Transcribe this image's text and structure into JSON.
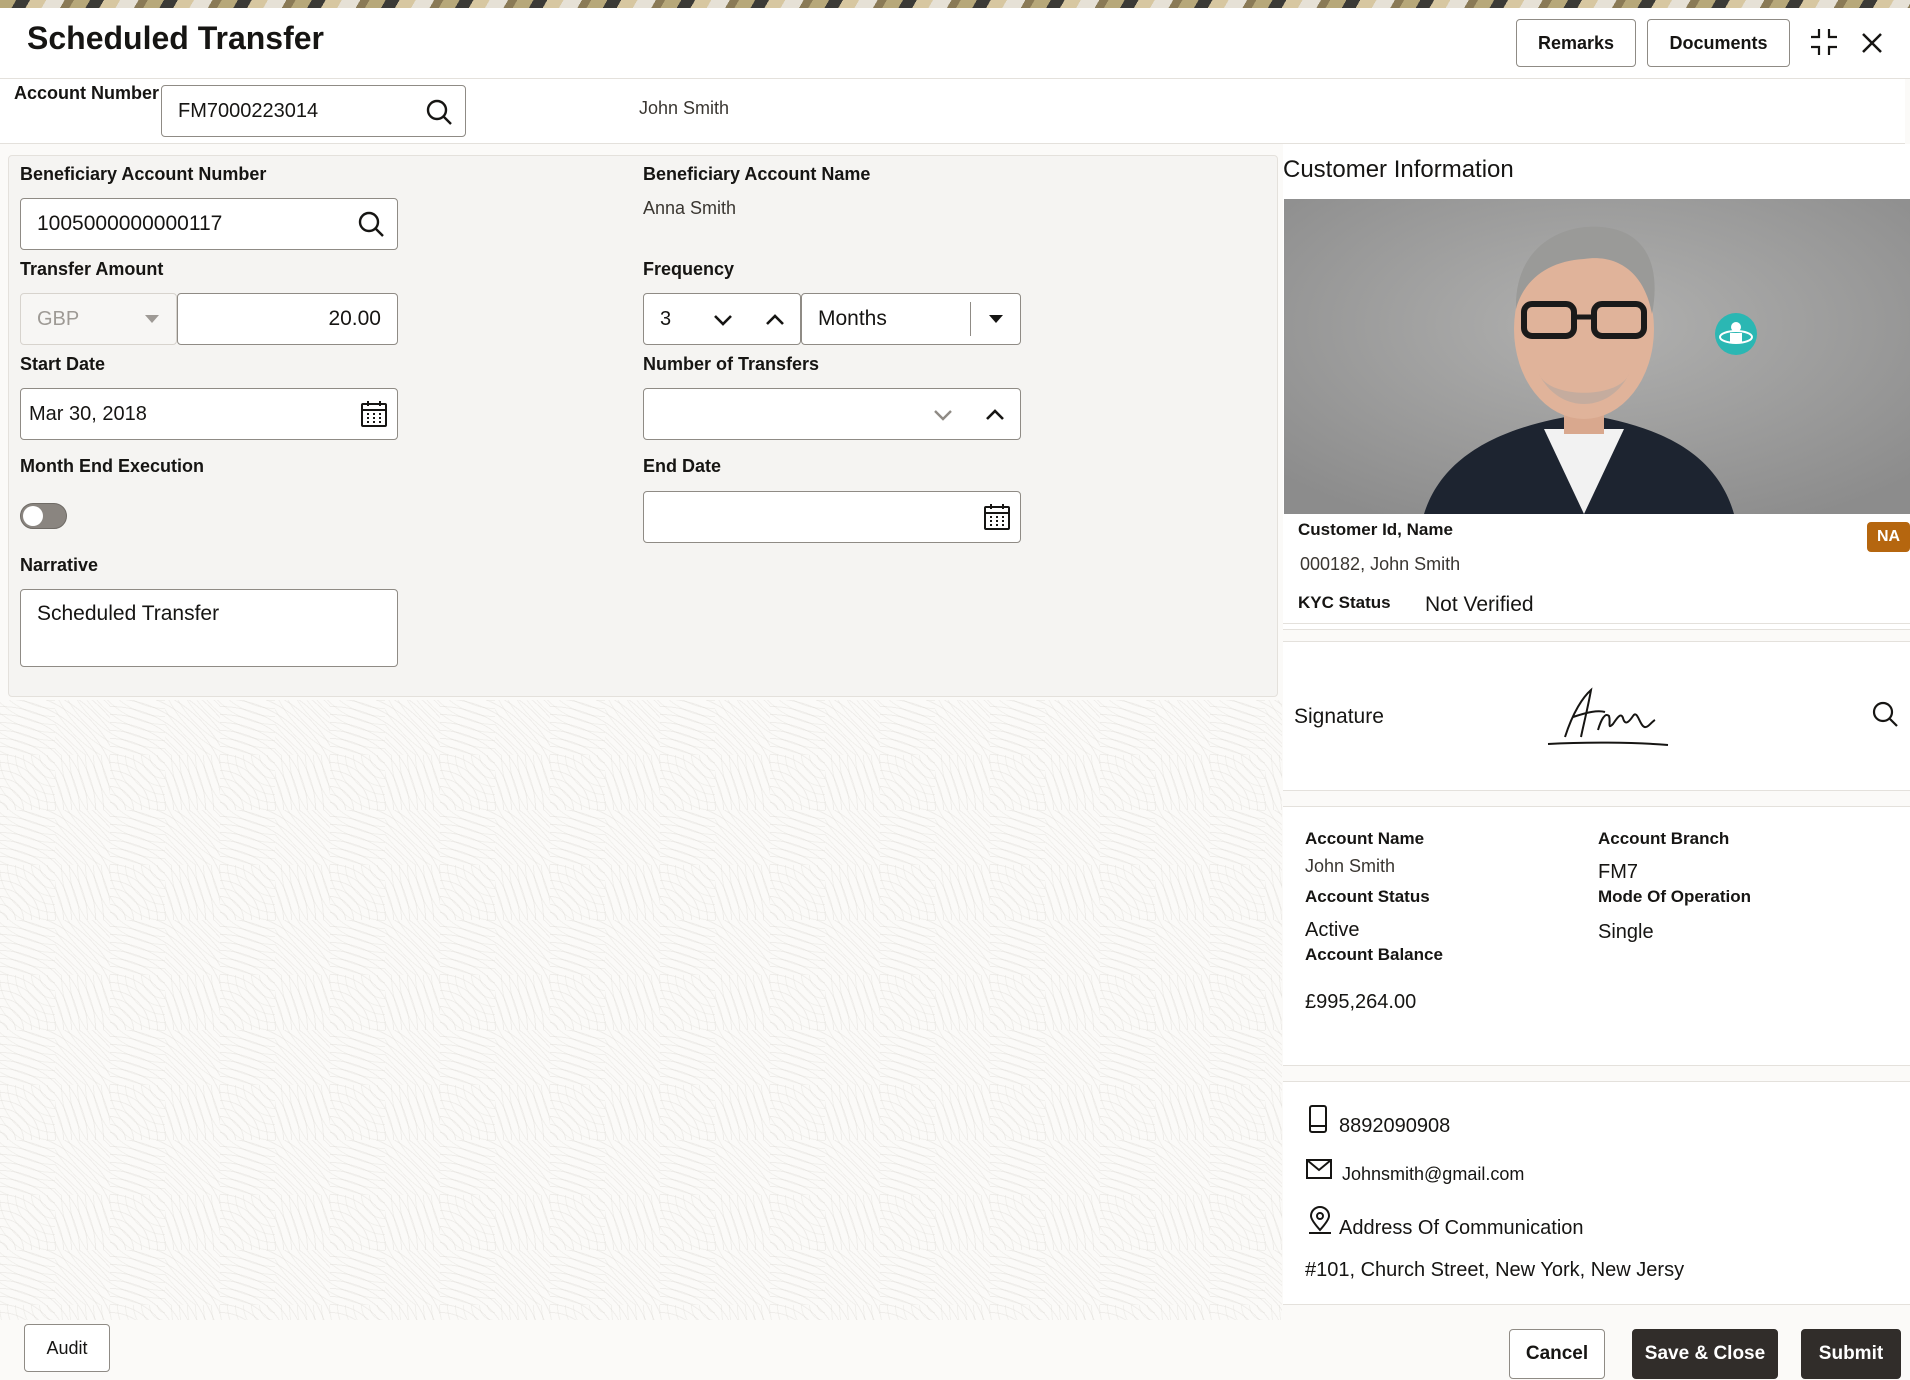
{
  "header": {
    "title": "Scheduled Transfer",
    "remarks_label": "Remarks",
    "documents_label": "Documents"
  },
  "account": {
    "label": "Account Number",
    "value": "FM7000223014",
    "holder_name": "John Smith"
  },
  "form": {
    "beneficiary_account_number": {
      "label": "Beneficiary Account Number",
      "value": "1005000000000117"
    },
    "beneficiary_account_name": {
      "label": "Beneficiary Account Name",
      "value": "Anna Smith"
    },
    "transfer_amount": {
      "label": "Transfer Amount",
      "currency": "GBP",
      "value": "20.00"
    },
    "frequency": {
      "label": "Frequency",
      "count": "3",
      "unit": "Months"
    },
    "start_date": {
      "label": "Start Date",
      "value": "Mar 30, 2018"
    },
    "number_of_transfers": {
      "label": "Number of Transfers",
      "value": ""
    },
    "month_end_execution": {
      "label": "Month End Execution",
      "enabled": false
    },
    "end_date": {
      "label": "End Date",
      "value": ""
    },
    "narrative": {
      "label": "Narrative",
      "value": "Scheduled Transfer"
    }
  },
  "customer": {
    "section_title": "Customer Information",
    "badge": "NA",
    "id_name_label": "Customer Id, Name",
    "id_name_value": "000182, John Smith",
    "kyc_label": "KYC Status",
    "kyc_value": "Not Verified",
    "signature_label": "Signature",
    "account_name_label": "Account Name",
    "account_name_value": "John Smith",
    "account_branch_label": "Account Branch",
    "account_branch_value": "FM7",
    "account_status_label": "Account Status",
    "account_status_value": "Active",
    "mode_label": "Mode Of Operation",
    "mode_value": "Single",
    "balance_label": "Account Balance",
    "balance_value": "£995,264.00",
    "phone": "8892090908",
    "email": "Johnsmith@gmail.com",
    "address_label": "Address Of Communication",
    "address_value": "#101, Church Street, New York, New Jersy"
  },
  "footer": {
    "audit_label": "Audit",
    "cancel_label": "Cancel",
    "save_close_label": "Save & Close",
    "submit_label": "Submit"
  },
  "colors": {
    "primary_button": "#312d2a",
    "badge": "#b5660f",
    "accent_teal": "#2bb7b3"
  }
}
